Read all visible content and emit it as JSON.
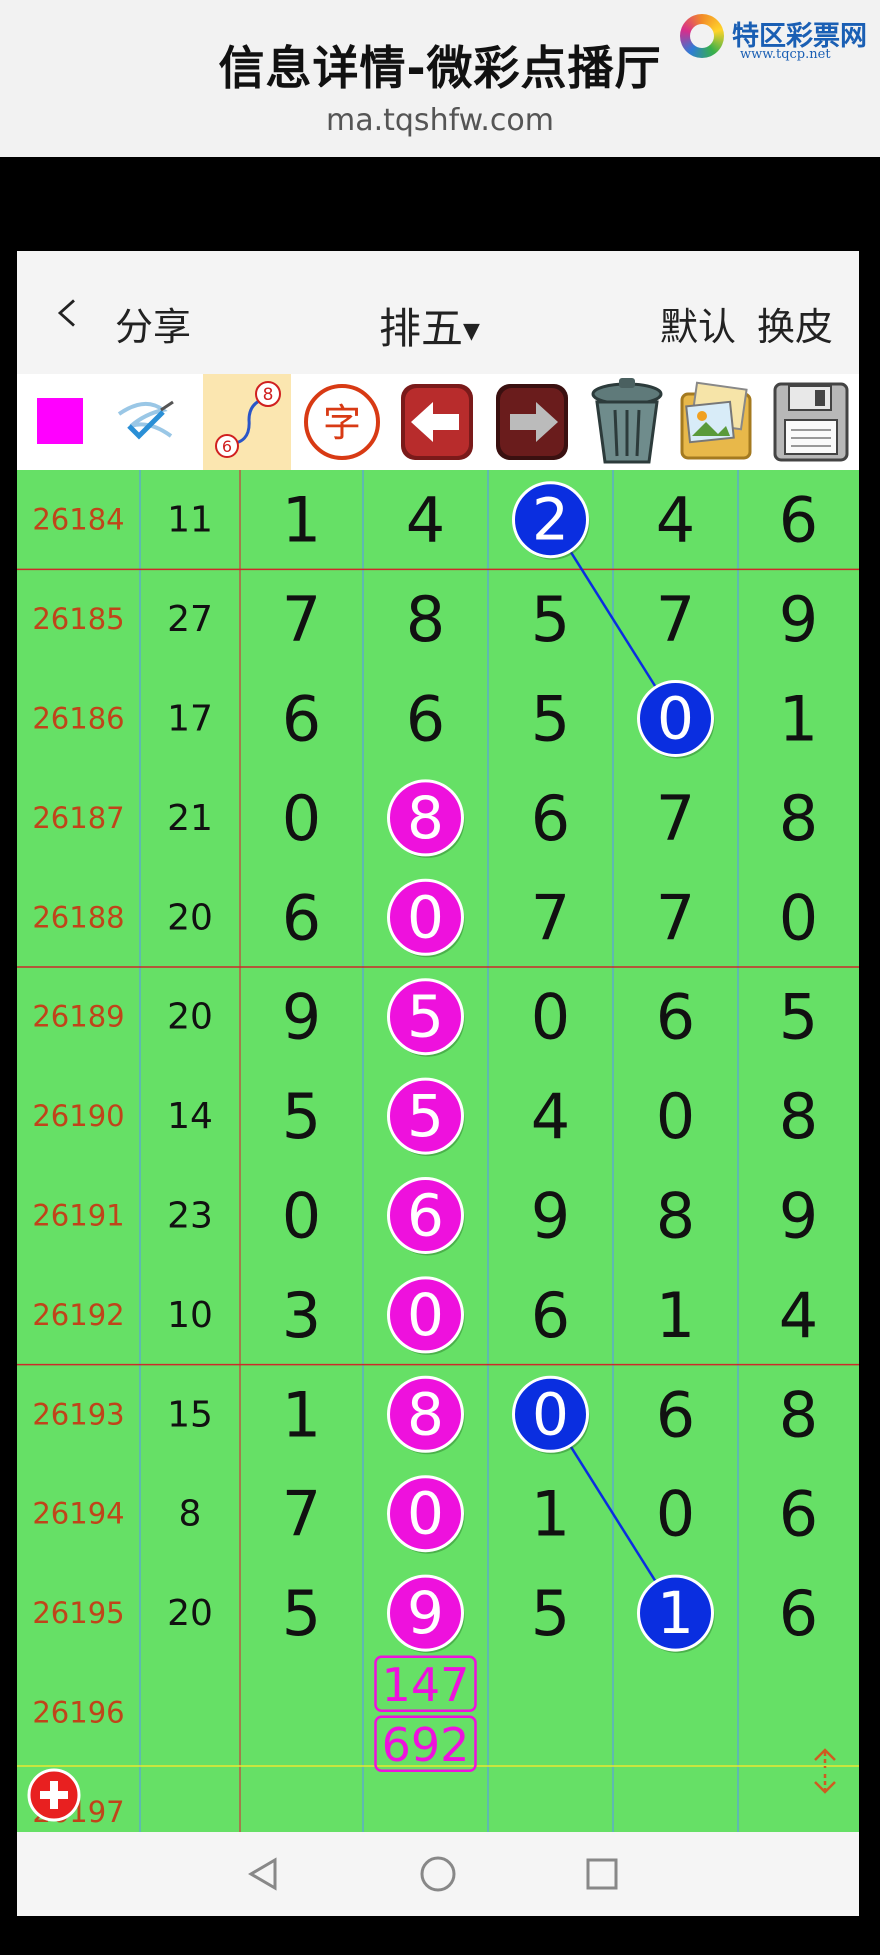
{
  "page": {
    "title": "信息详情-微彩点播厅",
    "url": "ma.tqshfw.com"
  },
  "logo": {
    "name": "特区彩票网",
    "site": "www.tqcp.net"
  },
  "header": {
    "share_label": "分享",
    "title": "排五",
    "default_label": "默认",
    "skin_label": "换皮"
  },
  "toolbar": {
    "colors": {
      "swatch": "#ff00ff"
    },
    "icons": [
      "color-swatch-icon",
      "pen-stroke-icon",
      "curve-6-8-icon",
      "char-zi-icon",
      "arrow-left-icon",
      "arrow-right-icon",
      "trash-icon",
      "photos-icon",
      "floppy-disk-icon"
    ],
    "curve_icon_numbers": [
      "6",
      "8"
    ],
    "char_icon_label": "字"
  },
  "table": {
    "rows": [
      {
        "issue": "26184",
        "sum": "11",
        "digits": [
          1,
          4,
          2,
          4,
          6
        ]
      },
      {
        "issue": "26185",
        "sum": "27",
        "digits": [
          7,
          8,
          5,
          7,
          9
        ]
      },
      {
        "issue": "26186",
        "sum": "17",
        "digits": [
          6,
          6,
          5,
          0,
          1
        ]
      },
      {
        "issue": "26187",
        "sum": "21",
        "digits": [
          0,
          8,
          6,
          7,
          8
        ]
      },
      {
        "issue": "26188",
        "sum": "20",
        "digits": [
          6,
          0,
          7,
          7,
          0
        ]
      },
      {
        "issue": "26189",
        "sum": "20",
        "digits": [
          9,
          5,
          0,
          6,
          5
        ]
      },
      {
        "issue": "26190",
        "sum": "14",
        "digits": [
          5,
          5,
          4,
          0,
          8
        ]
      },
      {
        "issue": "26191",
        "sum": "23",
        "digits": [
          0,
          6,
          9,
          8,
          9
        ]
      },
      {
        "issue": "26192",
        "sum": "10",
        "digits": [
          3,
          0,
          6,
          1,
          4
        ]
      },
      {
        "issue": "26193",
        "sum": "15",
        "digits": [
          1,
          8,
          0,
          6,
          8
        ]
      },
      {
        "issue": "26194",
        "sum": "8",
        "digits": [
          7,
          0,
          1,
          0,
          6
        ]
      },
      {
        "issue": "26195",
        "sum": "20",
        "digits": [
          5,
          9,
          5,
          1,
          6
        ]
      },
      {
        "issue": "26196",
        "sum": "",
        "digits": []
      },
      {
        "issue": "26197",
        "sum": "",
        "digits": []
      }
    ],
    "magenta_marks": [
      [
        3,
        1
      ],
      [
        4,
        1
      ],
      [
        5,
        1
      ],
      [
        6,
        1
      ],
      [
        7,
        1
      ],
      [
        8,
        1
      ],
      [
        9,
        1
      ],
      [
        10,
        1
      ],
      [
        11,
        1
      ]
    ],
    "blue_marks": [
      [
        0,
        2
      ],
      [
        2,
        3
      ],
      [
        9,
        2
      ],
      [
        11,
        3
      ]
    ],
    "blue_lines": [
      [
        [
          0,
          2
        ],
        [
          2,
          3
        ]
      ],
      [
        [
          9,
          2
        ],
        [
          11,
          3
        ]
      ]
    ],
    "prediction": {
      "row": 12,
      "col": 1,
      "lines": [
        "147",
        "692"
      ]
    },
    "colors": {
      "board": "#66e066",
      "issue_text": "#c0441a",
      "magenta": "#ee11dd",
      "blue": "#0a2ee0",
      "separator_red": "#cc2a2a",
      "grid_blue": "#5aa0e0",
      "grid_red": "#cc3a3a",
      "yellow_line": "#e8e830"
    }
  },
  "floating": {
    "add_icon": "plus-circle-icon",
    "expand_icon": "expand-arrows-icon"
  },
  "nav": {
    "icons": [
      "back-triangle-icon",
      "home-circle-icon",
      "recents-square-icon"
    ]
  }
}
